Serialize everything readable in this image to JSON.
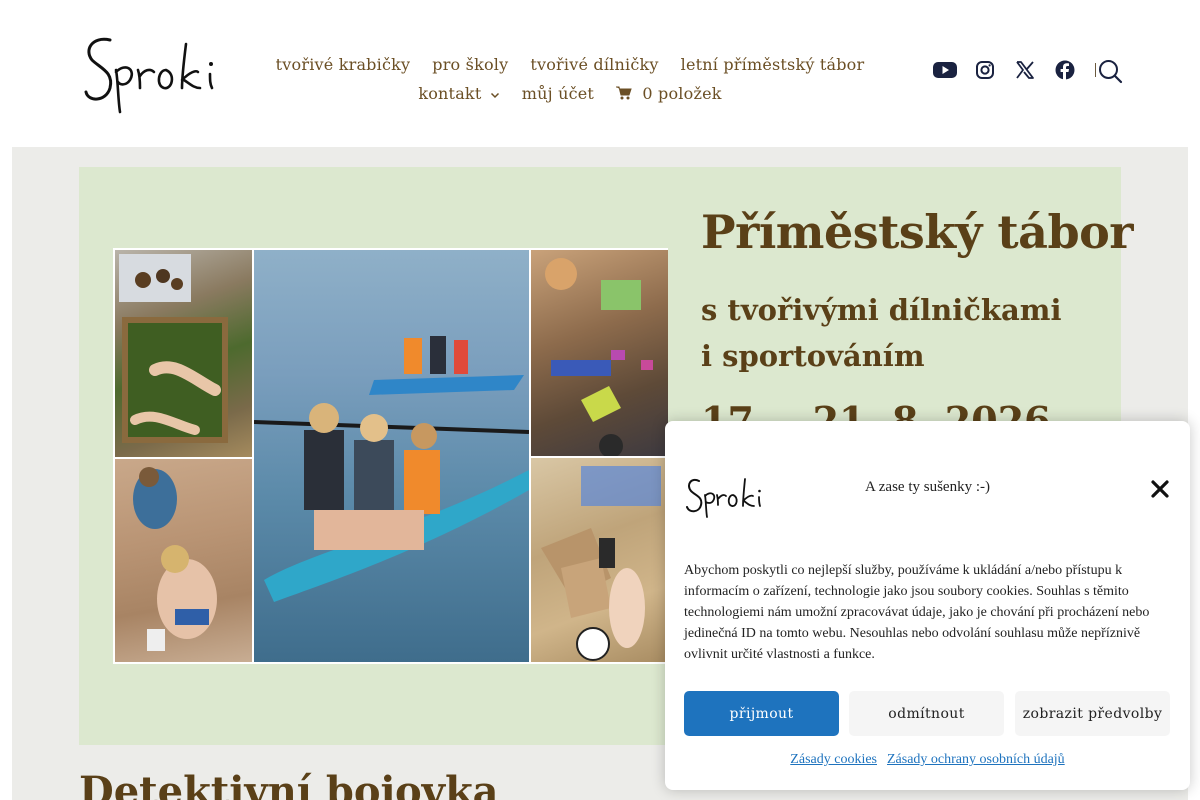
{
  "header": {
    "logo_text": "Sproki",
    "nav": {
      "row1": [
        "tvořivé krabičky",
        "pro školy",
        "tvořivé dílničky",
        "letní příměstský tábor"
      ],
      "kontakt": "kontakt",
      "account": "můj účet",
      "cart": "0 položek"
    },
    "social_icons": [
      "youtube-icon",
      "instagram-icon",
      "x-icon",
      "facebook-icon"
    ],
    "search_icon": "search-icon"
  },
  "hero": {
    "title": "Příměstský tábor",
    "subtitle": "s tvořivými dílničkami i sportováním",
    "date": "17. – 21. 8. 2026"
  },
  "next_section_title": "Detektivní bojovka",
  "cookie": {
    "logo_text": "Sproki",
    "title": "A zase ty sušenky :-)",
    "text": "Abychom poskytli co nejlepší služby, používáme k ukládání a/nebo přístupu k informacím o zařízení, technologie jako jsou soubory cookies. Souhlas s těmito technologiemi nám umožní zpracovávat údaje, jako je chování při procházení nebo jedinečná ID na tomto webu. Nesouhlas nebo odvolání souhlasu může nepříznivě ovlivnit určité vlastnosti a funkce.",
    "accept": "přijmout",
    "deny": "odmítnout",
    "prefs": "zobrazit předvolby",
    "link_cookies": "Zásady cookies",
    "link_privacy": "Zásady ochrany osobních údajů"
  },
  "colors": {
    "text_brown": "#5a4018",
    "nav_brown": "#6b4f25",
    "hero_bg": "#dce8cf",
    "page_bg": "#ecece9",
    "accent_blue": "#1e73be"
  }
}
